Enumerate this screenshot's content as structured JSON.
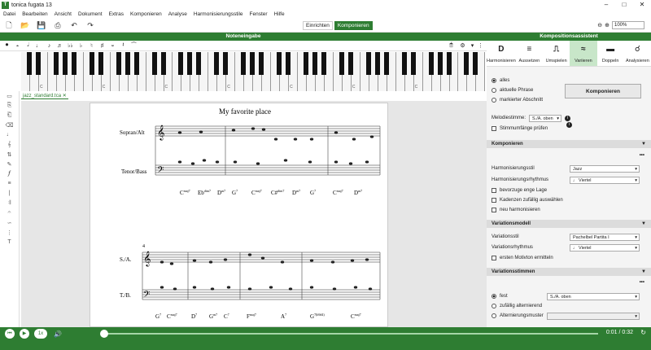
{
  "window": {
    "title": "tonica fugata 13"
  },
  "menu": [
    "Datei",
    "Bearbeiten",
    "Ansicht",
    "Dokument",
    "Extras",
    "Komponieren",
    "Analyse",
    "Harmonisierungsstile",
    "Fenster",
    "Hilfe"
  ],
  "toolbar": {
    "mode_setup": "Einrichten",
    "mode_compose": "Komponieren",
    "zoom": "100%"
  },
  "noteinput": {
    "header": "Noteneingabe"
  },
  "piano": {
    "octave_labels": [
      "C",
      "C",
      "C",
      "C",
      "C",
      "C",
      "C"
    ]
  },
  "document": {
    "tab": "jazz_standard.tca"
  },
  "score": {
    "title": "My favorite place",
    "system1": {
      "upper": "Sopran/Alt",
      "lower": "Tenor/Bass",
      "chords": [
        "C",
        "maj7",
        "Eb",
        "dim7",
        "D",
        "m7",
        "G",
        "7",
        "C",
        "maj7",
        "C#",
        "dim7",
        "D",
        "m7",
        "G",
        "7",
        "C",
        "maj7",
        "D",
        "m7"
      ]
    },
    "system2": {
      "measure": "4",
      "upper": "S./A.",
      "lower": "T./B.",
      "chords": [
        "G",
        "7",
        "C",
        "maj7",
        "D",
        "7",
        "G",
        "m7",
        "C",
        "7",
        "F",
        "maj7",
        "A",
        "7",
        "G",
        "7(b9#4)",
        "C",
        "maj7"
      ]
    }
  },
  "sidebar": {
    "header": "Kompositionsassistent",
    "tabs": [
      {
        "icon": "D",
        "label": "Harmonisieren"
      },
      {
        "icon": "≡",
        "label": "Aussetzen"
      },
      {
        "icon": "⎍",
        "label": "Umspielen"
      },
      {
        "icon": "≈",
        "label": "Variieren"
      },
      {
        "icon": "▬",
        "label": "Doppeln"
      },
      {
        "icon": "☌",
        "label": "Analysieren"
      }
    ],
    "scope": [
      "alles",
      "aktuelle Phrase",
      "markierter Abschnitt"
    ],
    "compose_button": "Komponieren",
    "melody_voice_label": "Melodiestimme:",
    "melody_voice": "S./A. oben",
    "range_check": "Stimmumfänge prüfen",
    "komponieren": {
      "title": "Komponieren",
      "style_label": "Harmonisierungsstil",
      "style": "Jazz",
      "rhythm_label": "Harmonisierungsrhythmus",
      "rhythm": "♩ Viertel",
      "checks": [
        "bevorzuge enge Lage",
        "Kadenzen zufällig auswählen",
        "neu harmonisieren"
      ]
    },
    "variation": {
      "title": "Variationsmodell",
      "style_label": "Variationsstil",
      "style": "Pachelbel Partita I",
      "rhythm_label": "Variationsrhythmus",
      "rhythm": "♩ Viertel",
      "check": "ersten Motivton ermitteln"
    },
    "voices": {
      "title": "Variationsstimmen",
      "options": [
        "fest",
        "zufällig alternierend",
        "Alternierungsmuster"
      ],
      "fixed_value": "S./A. oben"
    }
  },
  "player": {
    "time": "0:01 / 0:32",
    "speed": "1x"
  }
}
